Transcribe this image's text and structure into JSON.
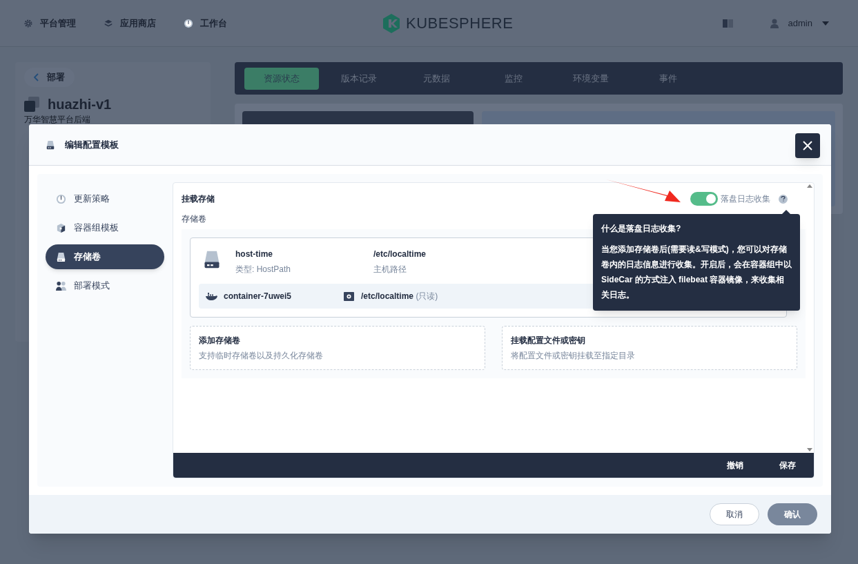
{
  "top_nav": {
    "items": [
      {
        "label": "平台管理",
        "kind": "gear"
      },
      {
        "label": "应用商店",
        "kind": "layers"
      },
      {
        "label": "工作台",
        "kind": "gauge"
      }
    ],
    "logo_text": "KUBESPHERE",
    "user": "admin"
  },
  "page": {
    "back_label": "部署",
    "title": "huazhi-v1",
    "subtitle": "万华智慧平台后端",
    "tabs": [
      {
        "label": "资源状态",
        "selected": true
      },
      {
        "label": "版本记录",
        "selected": false
      },
      {
        "label": "元数据",
        "selected": false
      },
      {
        "label": "监控",
        "selected": false
      },
      {
        "label": "环境变量",
        "selected": false
      },
      {
        "label": "事件",
        "selected": false
      }
    ]
  },
  "modal": {
    "title": "编辑配置模板",
    "nav": [
      {
        "label": "更新策略",
        "selected": false,
        "kind": "gauge"
      },
      {
        "label": "容器组模板",
        "selected": false,
        "kind": "cube"
      },
      {
        "label": "存储卷",
        "selected": true,
        "kind": "disk"
      },
      {
        "label": "部署模式",
        "selected": false,
        "kind": "people"
      }
    ],
    "section_title": "挂载存储",
    "toggle": {
      "label": "落盘日志收集",
      "on": true
    },
    "volumes_label": "存储卷",
    "volume": {
      "name": "host-time",
      "type": "类型: HostPath",
      "path": "/etc/localtime",
      "path_type": "主机路径",
      "container": "container-7uwei5",
      "mount_path": "/etc/localtime",
      "mount_mode": "(只读)"
    },
    "actions": [
      {
        "title": "添加存储卷",
        "desc": "支持临时存储卷以及持久化存储卷"
      },
      {
        "title": "挂载配置文件或密钥",
        "desc": "将配置文件或密钥挂载至指定目录"
      }
    ],
    "tooltip": {
      "title": "什么是落盘日志收集?",
      "body": "当您添加存储卷后(需要读&写模式)，您可以对存储卷内的日志信息进行收集。开启后，会在容器组中以 SideCar 的方式注入 filebeat 容器镜像，来收集相关日志。"
    },
    "panel_buttons": [
      "撤销",
      "保存"
    ],
    "footer_buttons": [
      {
        "label": "取消",
        "kind": "secondary"
      },
      {
        "label": "确认",
        "kind": "primary"
      }
    ]
  }
}
